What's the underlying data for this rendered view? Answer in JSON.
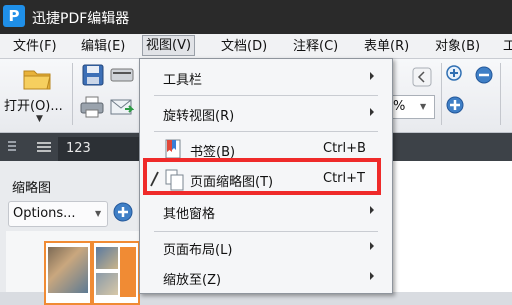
{
  "app": {
    "logo_letter": "P",
    "title": "迅捷PDF编辑器"
  },
  "menubar": {
    "items": [
      {
        "label": "文件(F)"
      },
      {
        "label": "编辑(E)"
      },
      {
        "label": "视图(V)"
      },
      {
        "label": "文档(D)"
      },
      {
        "label": "注释(C)"
      },
      {
        "label": "表单(R)"
      },
      {
        "label": "对象(B)"
      },
      {
        "label": "工"
      }
    ]
  },
  "toolbar": {
    "open_label": "打开(O)...",
    "zoom_value_fragment": "%",
    "icons": [
      "folder-icon",
      "save-icon",
      "scanner-icon",
      "print-icon",
      "email-icon",
      "zoom-in-icon",
      "zoom-out-icon",
      "zoom-fit-icon"
    ]
  },
  "tabs": {
    "doc_tab_label": "123"
  },
  "left_panel": {
    "title": "缩略图",
    "options_label": "Options..."
  },
  "view_menu": {
    "items": [
      {
        "label": "工具栏",
        "submenu": true
      },
      {
        "label": "旋转视图(R)",
        "submenu": true
      },
      {
        "label": "书签(B)",
        "shortcut": "Ctrl+B"
      },
      {
        "label": "页面缩略图(T)",
        "shortcut": "Ctrl+T",
        "checked": true,
        "highlighted": true
      },
      {
        "label": "其他窗格",
        "submenu": true
      },
      {
        "label": "页面布局(L)",
        "submenu": true
      },
      {
        "label": "缩放至(Z)",
        "submenu": true
      }
    ]
  },
  "colors": {
    "highlight": "#ef2a2a",
    "thumbnail_border": "#f08b34",
    "accent": "#1f8fe8"
  }
}
